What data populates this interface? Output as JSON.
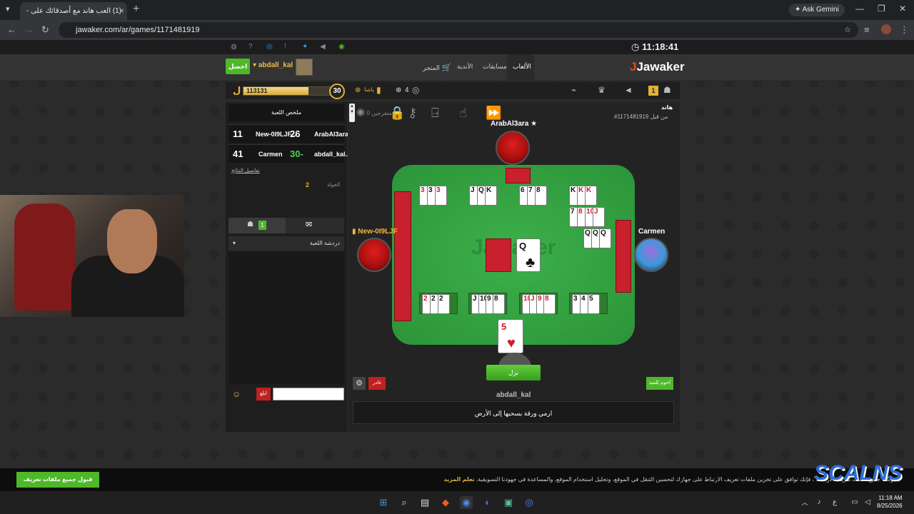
{
  "browser": {
    "tab_title": "(1) العب هاند مع أصدقائك على -",
    "new_tab": "+",
    "gemini": "✦ Ask Gemini",
    "url": "jawaker.com/ar/games/1171481919"
  },
  "site": {
    "clock": "11:18:41",
    "logo": "Jawaker",
    "nav": [
      "الألعاب",
      "مسابقات",
      "الأندية",
      "المتجر"
    ],
    "get_button": "احصل",
    "username": "abdall_kal"
  },
  "gamebar": {
    "coins_symbol": "ل",
    "xp_value": "113131",
    "xp_fraction": 0.72,
    "level": "30",
    "hand_label": "ياشا",
    "count": "4",
    "badge": "1"
  },
  "sidebar": {
    "title": "ملخص اللعبة",
    "scores": [
      {
        "left_num": "11",
        "left_name": "New-0I9LJF...",
        "right_num": "26",
        "right_name": "ArabAl3ara..."
      },
      {
        "left_num": "41",
        "left_name": "Carmen",
        "right_num": "30-",
        "right_name": "abdall_kal..."
      }
    ],
    "details_link": "تفاصيل النتائج",
    "round_label": "الجولة",
    "round_value": "2",
    "online_count": "1",
    "chat_dropdown": "دردشة اللعبة",
    "send_label": "ابلغ"
  },
  "game": {
    "title": "هاند",
    "game_id": "#1171481919 من قبل",
    "spectators": "0 متفرجين",
    "players": {
      "top": "ArabAl3ara ★",
      "left": "New-0I9LJF",
      "right": "Carmen",
      "bottom": "abdall_kal"
    },
    "top_melds": [
      [
        "3",
        "3",
        "3"
      ],
      [
        "J",
        "Q",
        "K"
      ],
      [
        "6",
        "7",
        "8"
      ],
      [
        "K",
        "K",
        "K"
      ]
    ],
    "right_melds": [
      [
        "7",
        "8",
        "10",
        "J"
      ],
      [
        "Q",
        "Q",
        "Q"
      ]
    ],
    "bottom_melds": [
      [
        "2",
        "2",
        "2"
      ],
      [
        "J",
        "10",
        "9",
        "8"
      ],
      [
        "10",
        "J",
        "9",
        "8"
      ],
      [
        "3",
        "4",
        "5"
      ]
    ],
    "discard_card": {
      "rank": "Q",
      "suit": "♣"
    },
    "hand_card": {
      "rank": "5",
      "suit": "♥"
    },
    "watermark": "Jawaker",
    "throw_button": "نزل",
    "rules_button": "احوم للعبة",
    "leave_button": "غادر",
    "message": "ارمي ورقة بسحبها إلى الأرض"
  },
  "cookie": {
    "accept_button": "قبول جميع ملفات تعريف الارتباط",
    "text": "بقبولك \"جميع ملفات تعريف الارتباط\"، فإنك توافق على تخزين ملفات تعريف الارتباط على جهازك لتحسين التنقل في الموقع، وتحليل استخدام الموقع، والمساعدة في جهودنا التسويقية.",
    "more": "تعلم المزيد"
  },
  "brand_overlay": "SCALNS",
  "taskbar": {
    "time": "11:18 AM",
    "date": "8/25/2026",
    "lang": "ع"
  },
  "colors": {
    "felt": "#3cb04a",
    "card_back": "#c8202c",
    "accent_green": "#4eb82a",
    "gold": "#e3b233"
  }
}
